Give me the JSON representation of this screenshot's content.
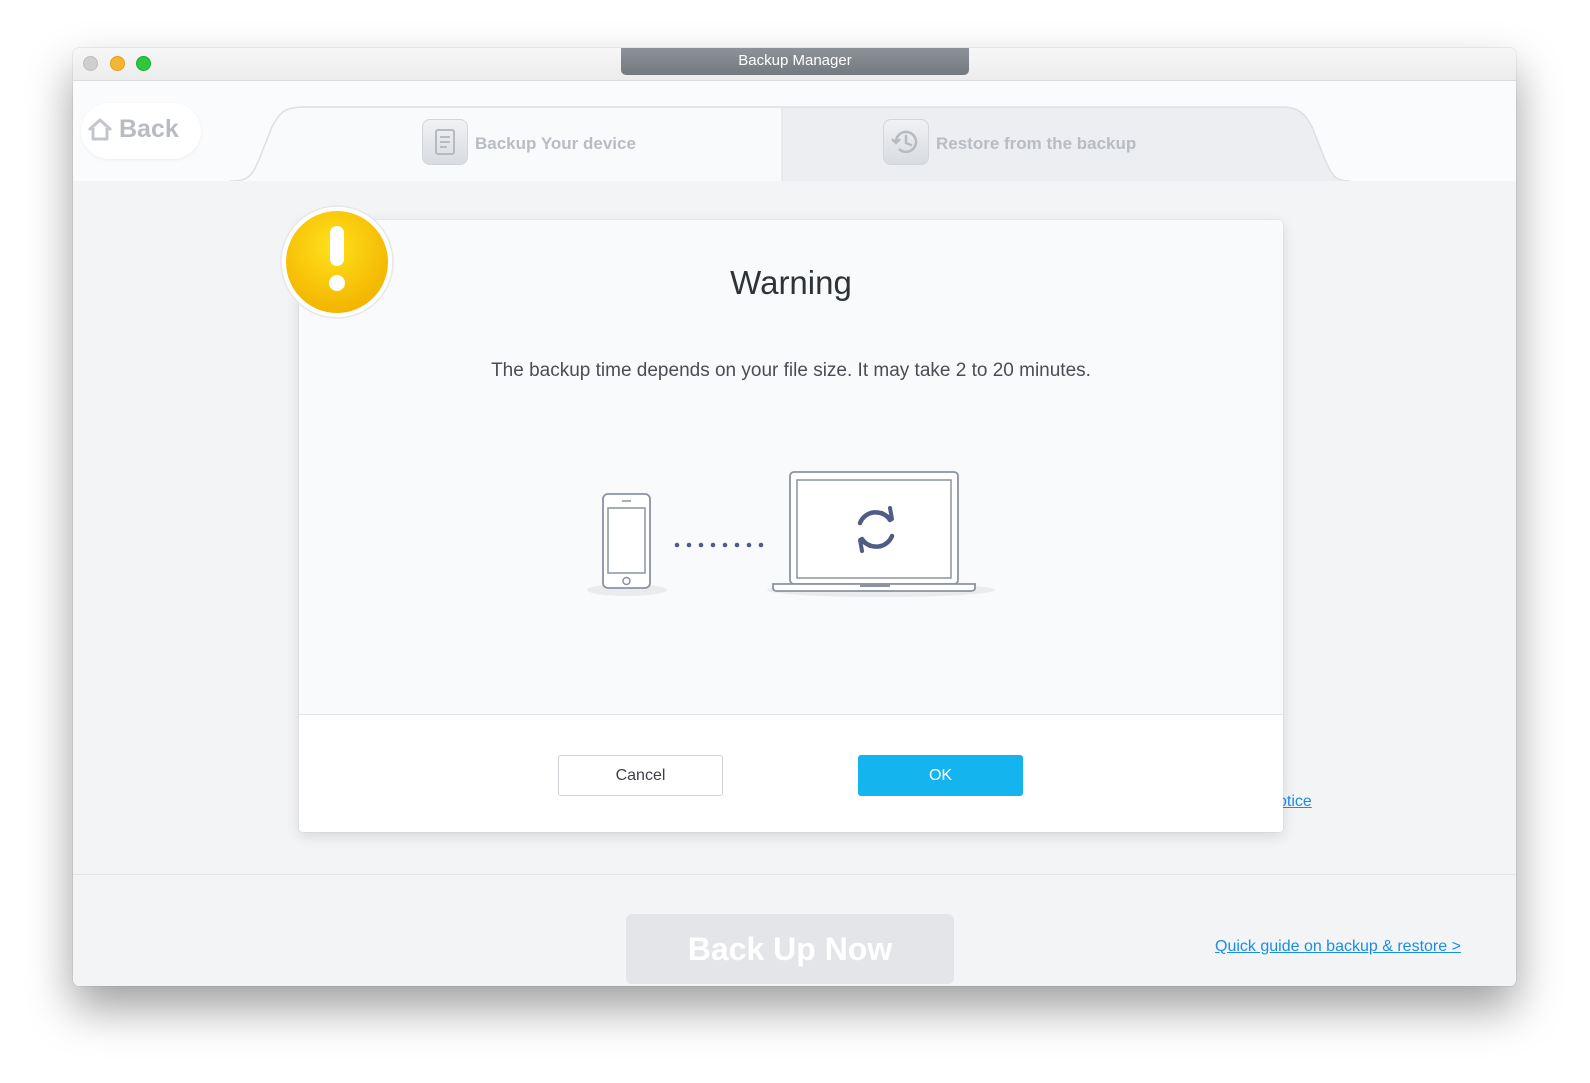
{
  "window": {
    "title": "Backup Manager"
  },
  "header": {
    "back_label": "Back",
    "tabs": [
      {
        "label": "Backup Your device",
        "icon": "document-icon"
      },
      {
        "label": "Restore from the backup",
        "icon": "history-icon"
      }
    ]
  },
  "dialog": {
    "title": "Warning",
    "message": "The backup time depends on your file size. It may take 2 to 20 minutes.",
    "cancel_label": "Cancel",
    "ok_label": "OK",
    "badge_icon": "exclamation-icon",
    "illustration_icons": [
      "phone-icon",
      "laptop-icon",
      "sync-icon"
    ]
  },
  "background": {
    "notice_link_partial": "otice",
    "back_up_now_label": "Back Up Now",
    "quick_guide_link": "Quick guide on backup & restore >"
  },
  "colors": {
    "accent": "#14b4ef",
    "link": "#1a8ee6",
    "warning": "#f7c500",
    "traffic_close": "#cfcfcf",
    "traffic_minimize": "#f5b731",
    "traffic_maximize": "#2dc840"
  }
}
